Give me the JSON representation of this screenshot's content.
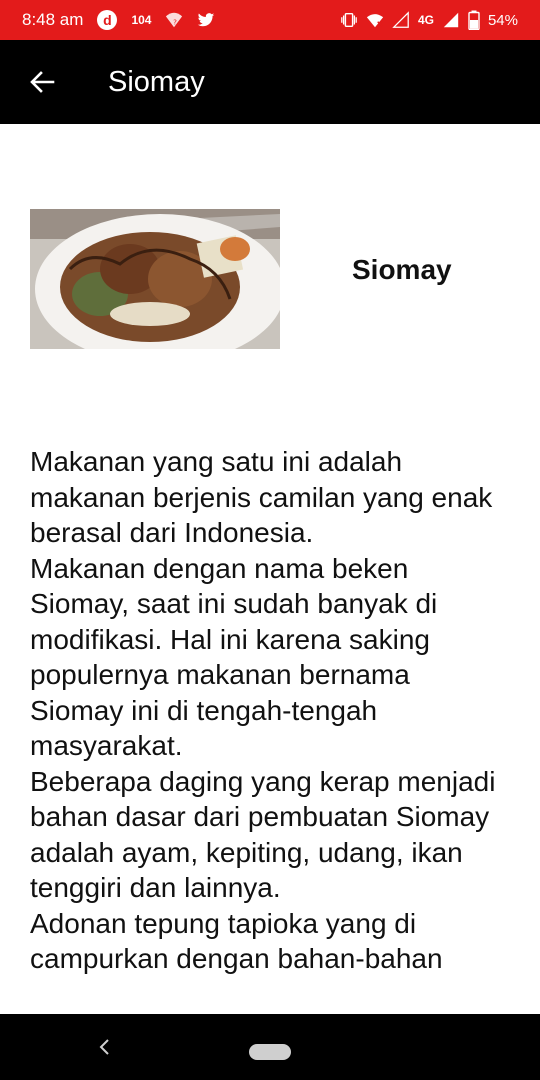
{
  "status_bar": {
    "time": "8:48 am",
    "notification_badge": "d",
    "notification_count": "104",
    "battery": "54%",
    "network_label": "4G"
  },
  "app_bar": {
    "title": "Siomay"
  },
  "content": {
    "dish_title": "Siomay",
    "description": "Makanan yang satu ini adalah makanan berjenis camilan yang enak berasal dari Indonesia.\nMakanan dengan nama beken Siomay, saat ini sudah banyak di modifikasi. Hal ini karena saking populernya makanan bernama Siomay ini di tengah-tengah masyarakat.\nBeberapa daging yang kerap menjadi bahan dasar dari pembuatan Siomay adalah ayam, kepiting, udang, ikan tenggiri dan lainnya.\nAdonan tepung tapioka yang di campurkan dengan bahan-bahan"
  },
  "colors": {
    "status_bar": "#e31b1b",
    "app_bar": "#000000",
    "nav_bar": "#000000"
  }
}
